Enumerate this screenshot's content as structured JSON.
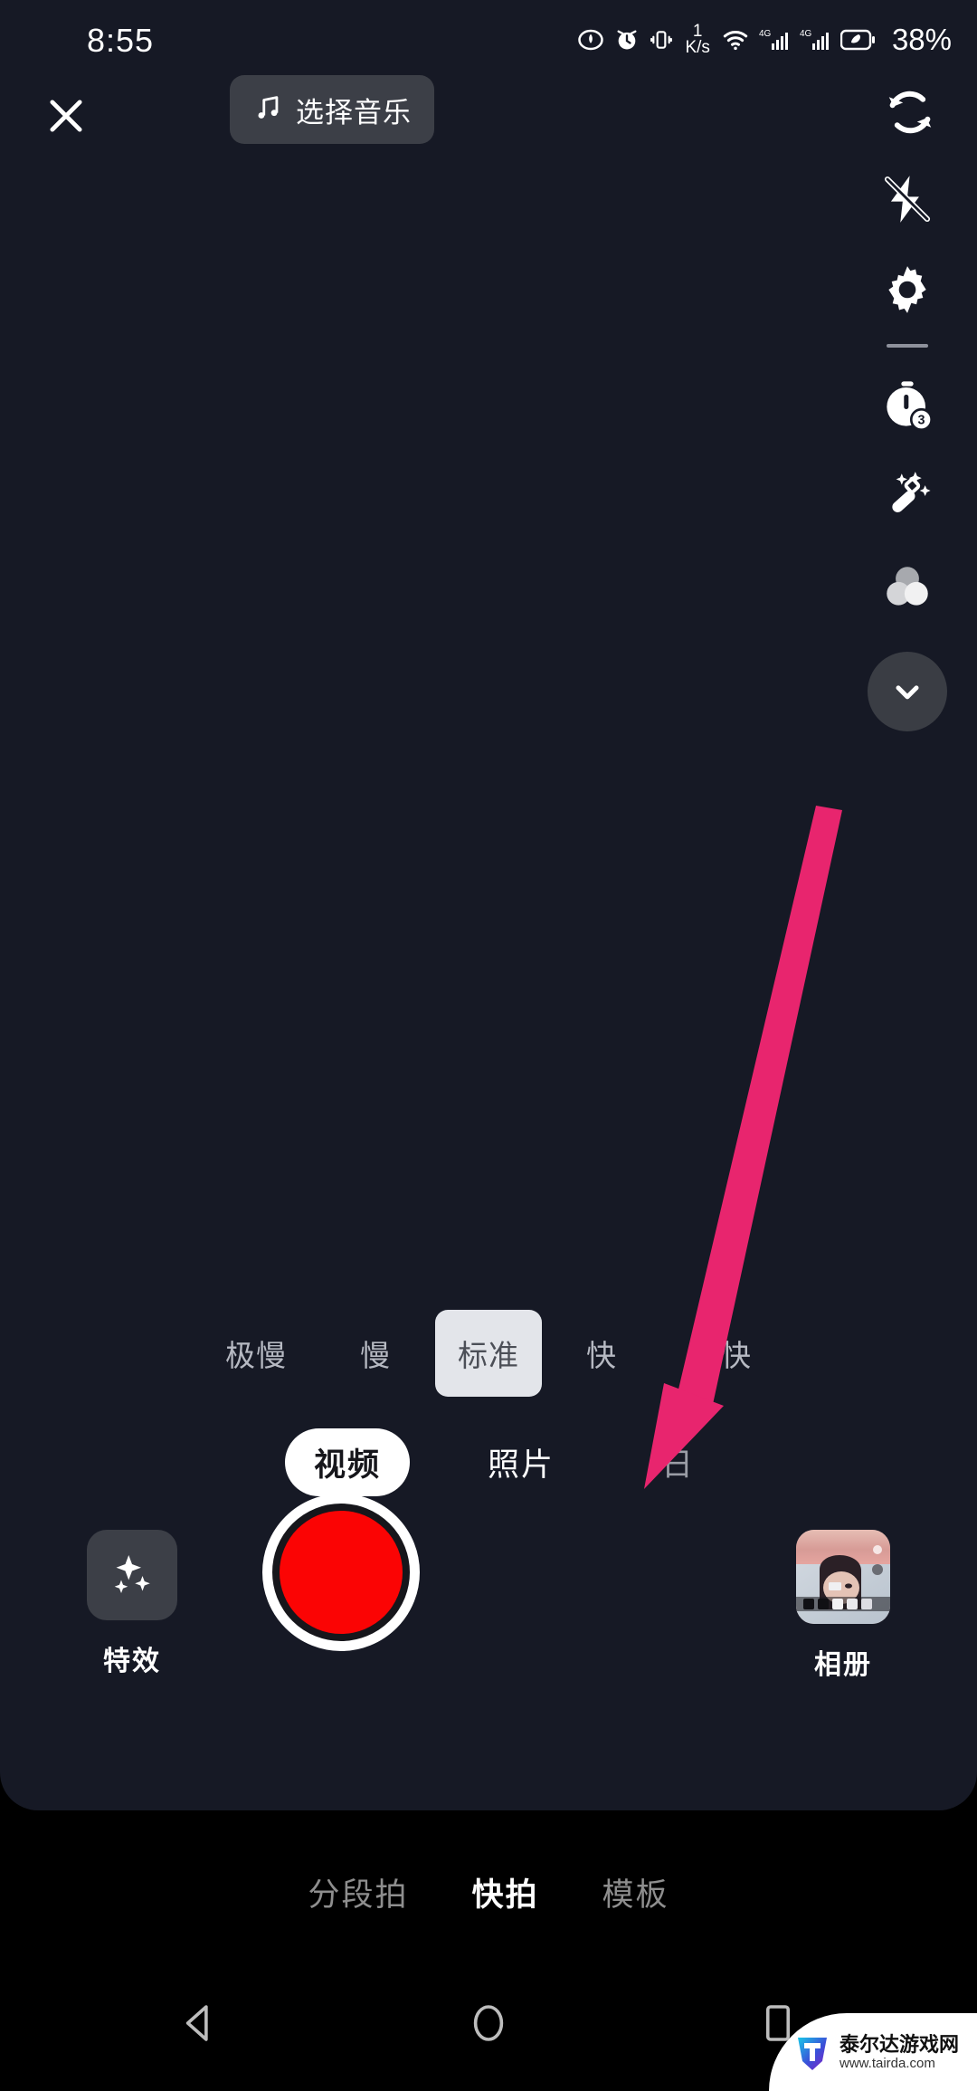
{
  "status_bar": {
    "time": "8:55",
    "net_speed_value": "1",
    "net_speed_unit": "K/s",
    "battery_percent": "38%",
    "icons": [
      "eye-icon",
      "alarm-icon",
      "vibrate-icon",
      "wifi-icon",
      "signal-4g-icon",
      "signal-4g-icon-2",
      "battery-icon"
    ]
  },
  "top_bar": {
    "close_label": "×",
    "music_label": "选择音乐",
    "music_icon": "music-note-icon",
    "flip_icon": "flip-camera-icon"
  },
  "right_rail": {
    "items": [
      {
        "name": "flash-off-icon",
        "label": ""
      },
      {
        "name": "settings-gear-icon",
        "label": ""
      },
      {
        "name": "countdown-timer-icon",
        "label": "3"
      },
      {
        "name": "beauty-wand-icon",
        "label": ""
      },
      {
        "name": "filter-circles-icon",
        "label": ""
      },
      {
        "name": "chevron-down-icon",
        "label": ""
      }
    ],
    "timer_badge": "3"
  },
  "speed_selector": {
    "options": [
      {
        "label": "极慢",
        "selected": false
      },
      {
        "label": "慢",
        "selected": false
      },
      {
        "label": "标准",
        "selected": true
      },
      {
        "label": "快",
        "selected": false
      },
      {
        "label": "极快",
        "selected": false
      }
    ]
  },
  "mode_tabs": {
    "options": [
      {
        "label": "视频",
        "selected": true
      },
      {
        "label": "照片",
        "selected": false
      },
      {
        "label": "日",
        "selected": false
      }
    ]
  },
  "capture": {
    "effects_label": "特效",
    "effects_icon": "sparkles-icon",
    "record_button": "record-button",
    "album_label": "相册",
    "album_thumb": "album-thumbnail"
  },
  "bottom_tabs": {
    "options": [
      {
        "label": "分段拍",
        "selected": false
      },
      {
        "label": "快拍",
        "selected": true
      },
      {
        "label": "模板",
        "selected": false
      }
    ]
  },
  "nav_bar": {
    "back": "back-triangle-icon",
    "home": "home-circle-icon",
    "recents": "recents-square-icon"
  },
  "watermark": {
    "site_name": "泰尔达游戏网",
    "url": "www.tairda.com"
  },
  "annotation": {
    "arrow_color": "#e8256e",
    "arrow_target": "照片"
  },
  "colors": {
    "app_background": "#161925",
    "accent_record": "#fb0404",
    "annotation_pink": "#e8256e",
    "chip_background": "#3c3f47",
    "selected_speed_bg": "#e3e5ea"
  }
}
